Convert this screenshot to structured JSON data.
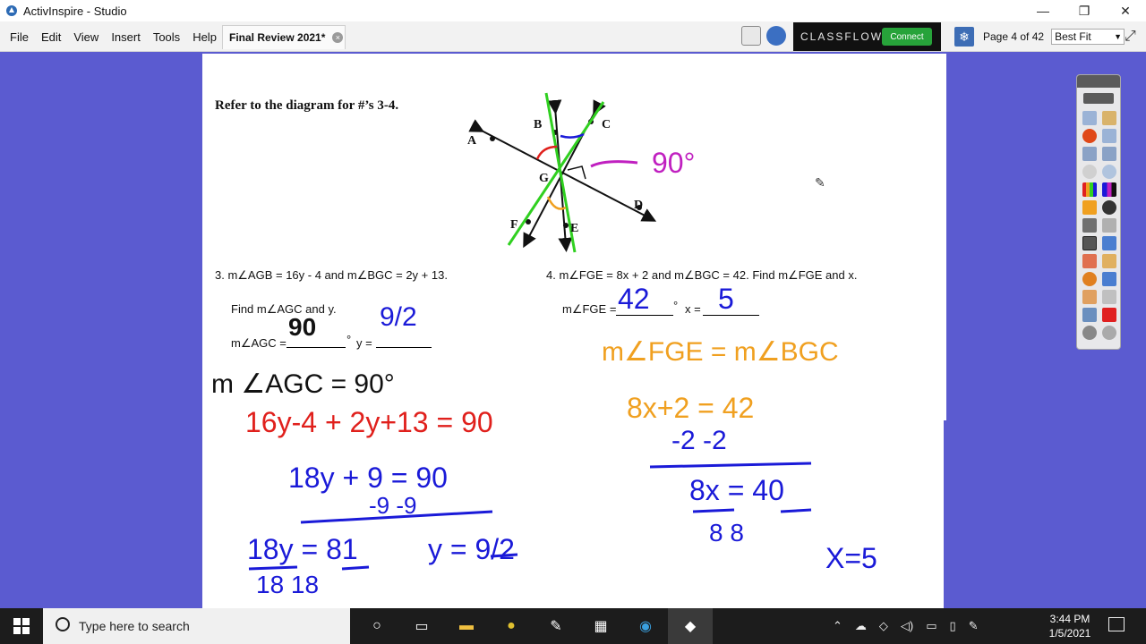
{
  "window": {
    "title": "ActivInspire - Studio",
    "minimize": "—",
    "maximize": "❐",
    "close": "✕"
  },
  "menu": [
    "File",
    "Edit",
    "View",
    "Insert",
    "Tools",
    "Help"
  ],
  "doc_tab": {
    "label": "Final Review 2021*"
  },
  "classflow": {
    "brand": "CLASSFLOW",
    "connect_label": "Connect"
  },
  "page_indicator": "Page 4 of 42",
  "zoom_select": "Best Fit",
  "worksheet": {
    "heading": "Refer to the diagram for #’s 3-4.",
    "diagram_labels": [
      "A",
      "B",
      "C",
      "G",
      "D",
      "F",
      "E"
    ],
    "q3": {
      "line": "3.  m∠AGB = 16y - 4  and  m∠BGC = 2y + 13.",
      "find": "Find  m∠AGC  and  y.",
      "answer_angle_label": "m∠AGC =",
      "degree": "°",
      "answer_y_label": "y ="
    },
    "q4": {
      "line": "4.  m∠FGE = 8x + 2  and  m∠BGC = 42.  Find  m∠FGE  and  x.",
      "answer_angle_label": "m∠FGE =",
      "degree": "°",
      "answer_x_label": "x ="
    },
    "handwriting": {
      "angle_note": "90°",
      "q3_angle": "90",
      "q3_y": "9/2",
      "q4_angle": "42",
      "q4_x": "5",
      "left": [
        "m ∠AGC = 90°",
        "16y-4 + 2y+13 = 90",
        "18y + 9 = 90",
        "-9   -9",
        "18y = 81",
        "18     18",
        "y = 9/2"
      ],
      "right": [
        "m∠FGE = m∠BGC",
        "8x+2 = 42",
        "-2   -2",
        "8x = 40",
        "8      8",
        "X=5"
      ]
    }
  },
  "taskbar": {
    "search_placeholder": "Type here to search",
    "time": "3:44 PM",
    "date": "1/5/2021"
  },
  "colors": {
    "desktop": "#5b5bd0",
    "ink_blue": "#1a1ad8",
    "ink_red": "#e0201c",
    "ink_orange": "#f0a020",
    "ink_magenta": "#c020c0",
    "ink_green": "#30d020"
  }
}
